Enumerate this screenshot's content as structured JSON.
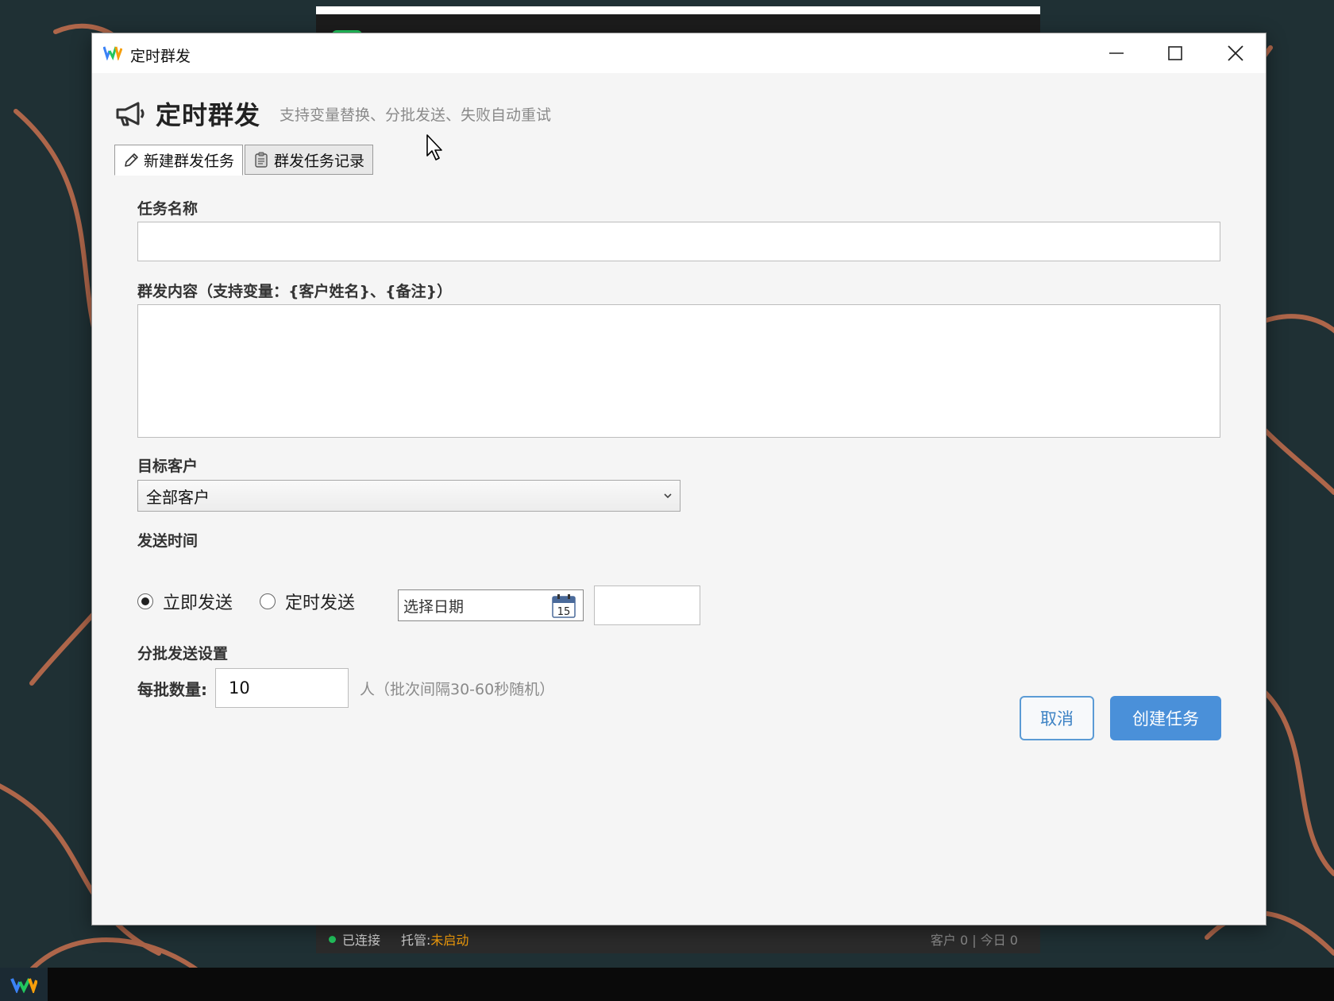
{
  "window": {
    "title": "定时群发",
    "controls": [
      "minimize",
      "maximize",
      "close"
    ]
  },
  "header": {
    "title": "定时群发",
    "subtitle": "支持变量替换、分批发送、失败自动重试",
    "icon": "megaphone-icon"
  },
  "tabs": [
    {
      "label": "新建群发任务",
      "icon": "pencil-icon",
      "active": true
    },
    {
      "label": "群发任务记录",
      "icon": "clipboard-icon",
      "active": false
    }
  ],
  "form": {
    "task_name": {
      "label": "任务名称",
      "value": ""
    },
    "content": {
      "label": "群发内容（支持变量：{客户姓名}、{备注}）",
      "value": ""
    },
    "target": {
      "label": "目标客户",
      "selected": "全部客户"
    },
    "send_time": {
      "label": "发送时间",
      "options": [
        "立即发送",
        "定时发送"
      ],
      "selected": "立即发送",
      "date_placeholder": "选择日期",
      "calendar_day": "15",
      "time_value": ""
    },
    "batch": {
      "section_label": "分批发送设置",
      "per_batch_label": "每批数量:",
      "per_batch_value": "10",
      "hint": "人（批次间隔30-60秒随机）"
    }
  },
  "buttons": {
    "cancel": "取消",
    "create": "创建任务"
  },
  "background_app": {
    "status_connected": "已连接",
    "managed_label": "托管:",
    "managed_value": "未启动",
    "stats": "客户 0 | 今日 0"
  },
  "colors": {
    "primary": "#4a90d9",
    "connected": "#22c55e",
    "warning": "#f59e0b",
    "dialog_bg": "#f5f5f5"
  }
}
